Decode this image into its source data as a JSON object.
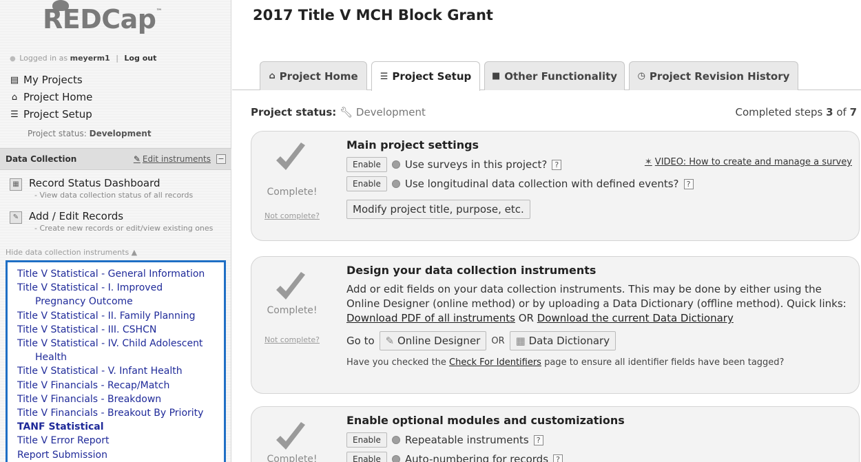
{
  "sidebar": {
    "logo": "REDCap",
    "logo_tm": "™",
    "logged_in_prefix": "Logged in as",
    "username": "meyerm1",
    "logout": "Log out",
    "nav": [
      {
        "label": "My Projects",
        "icon": "list-icon"
      },
      {
        "label": "Project Home",
        "icon": "home-icon"
      },
      {
        "label": "Project Setup",
        "icon": "setup-list-icon"
      }
    ],
    "status_label": "Project status:",
    "status_value": "Development",
    "data_collection": {
      "title": "Data Collection",
      "edit_label": "Edit instruments",
      "collapse": "−",
      "items": [
        {
          "label": "Record Status Dashboard",
          "sub": "- View data collection status of all records"
        },
        {
          "label": "Add / Edit Records",
          "sub": "- Create new records or edit/view existing ones"
        }
      ],
      "hide_instruments": "Hide data collection instruments ▲"
    },
    "instruments": [
      "Title V Statistical - General Information",
      "Title V Statistical - I. Improved",
      "Pregnancy Outcome",
      "Title V Statistical - II. Family Planning",
      "Title V Statistical - III. CSHCN",
      "Title V Statistical - IV. Child Adolescent",
      "Health",
      "Title V Statistical - V. Infant Health",
      "Title V Financials - Recap/Match",
      "Title V Financials - Breakdown",
      "Title V Financials - Breakout By Priority",
      "TANF Statistical",
      "Title V Error Report",
      "Report Submission"
    ]
  },
  "main": {
    "title": "2017 Title V MCH Block Grant",
    "tabs": [
      {
        "label": "Project Home",
        "icon": "⌂"
      },
      {
        "label": "Project Setup",
        "icon": "☰"
      },
      {
        "label": "Other Functionality",
        "icon": "■"
      },
      {
        "label": "Project Revision History",
        "icon": "◷"
      }
    ],
    "status_key": "Project status:",
    "status_value": "Development",
    "steps_prefix": "Completed steps",
    "steps_done": "3",
    "steps_of": "of",
    "steps_total": "7",
    "complete_label": "Complete!",
    "not_complete_label": "Not complete?",
    "cards": {
      "main_settings": {
        "title": "Main project settings",
        "enable_label": "Enable",
        "surveys": "Use surveys in this project?",
        "longitudinal": "Use longitudinal data collection with defined events?",
        "video": "VIDEO: How to create and manage a survey",
        "modify": "Modify project title, purpose, etc."
      },
      "design": {
        "title": "Design your data collection instruments",
        "desc": "Add or edit fields on your data collection instruments. This may be done by either using the Online Designer (online method) or by uploading a Data Dictionary (offline method). Quick links:",
        "download_pdf": "Download PDF of all instruments",
        "or": "OR",
        "download_dict": "Download the current Data Dictionary",
        "goto": "Go to",
        "online_designer": "Online Designer",
        "data_dictionary": "Data Dictionary",
        "identifiers_prefix": "Have you checked the",
        "identifiers_link": "Check For Identifiers",
        "identifiers_suffix": "page to ensure all identifier fields have been tagged?"
      },
      "optional": {
        "title": "Enable optional modules and customizations",
        "enable_label": "Enable",
        "repeatable": "Repeatable instruments",
        "autonumber": "Auto-numbering for records"
      }
    },
    "help": "?"
  }
}
